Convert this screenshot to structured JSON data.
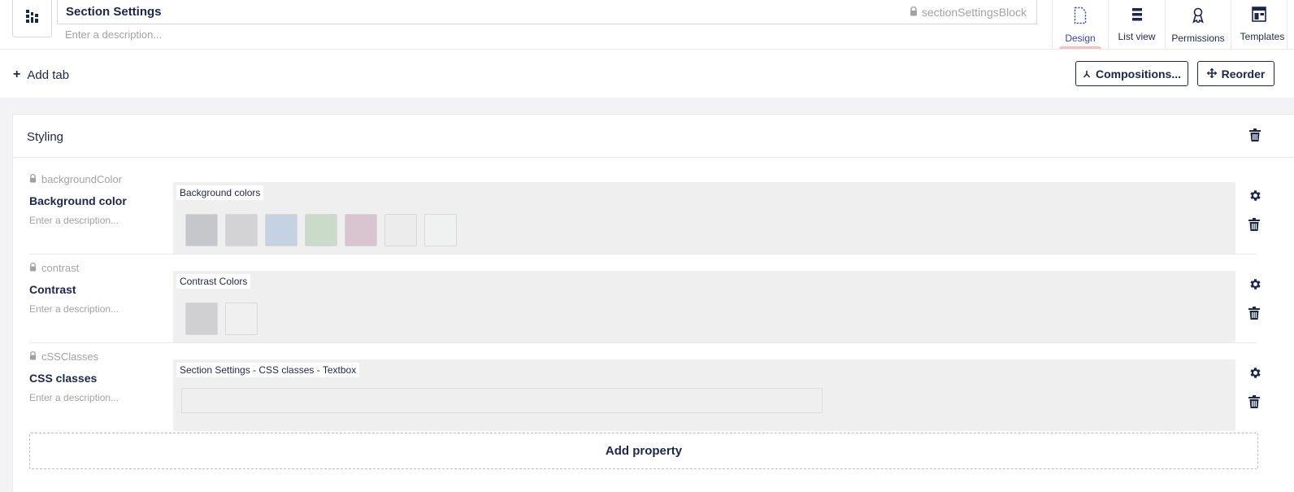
{
  "header": {
    "name": "Section Settings",
    "alias": "sectionSettingsBlock",
    "description_placeholder": "Enter a description..."
  },
  "apps": [
    {
      "label": "Design",
      "icon": "document-icon",
      "active": true
    },
    {
      "label": "List view",
      "icon": "list-icon",
      "active": false
    },
    {
      "label": "Permissions",
      "icon": "ribbon-icon",
      "active": false
    },
    {
      "label": "Templates",
      "icon": "layout-icon",
      "active": false
    }
  ],
  "toolbar": {
    "add_tab_label": "Add tab",
    "compositions_label": "Compositions...",
    "reorder_label": "Reorder"
  },
  "group": {
    "title": "Styling",
    "properties": [
      {
        "alias": "backgroundColor",
        "label": "Background color",
        "description_placeholder": "Enter a description...",
        "editor_name": "Background colors",
        "swatches": [
          "#c6c7ca",
          "#d3d3d6",
          "#c4d2e2",
          "#cbdbca",
          "#d9c5cf",
          "#ececed",
          "#f0f1f1"
        ]
      },
      {
        "alias": "contrast",
        "label": "Contrast",
        "description_placeholder": "Enter a description...",
        "editor_name": "Contrast Colors",
        "swatches": [
          "#d0d0d3",
          "#f0f0f0"
        ]
      },
      {
        "alias": "cSSClasses",
        "label": "CSS classes",
        "description_placeholder": "Enter a description...",
        "editor_name": "Section Settings - CSS classes - Textbox",
        "value": ""
      }
    ],
    "add_property_label": "Add property"
  },
  "colors": {
    "primary": "#1b264f",
    "active_tab": "#3544b1",
    "active_indicator": "#f5c1bc",
    "muted_text": "#a2a1a6",
    "background": "#f3f3f5"
  }
}
